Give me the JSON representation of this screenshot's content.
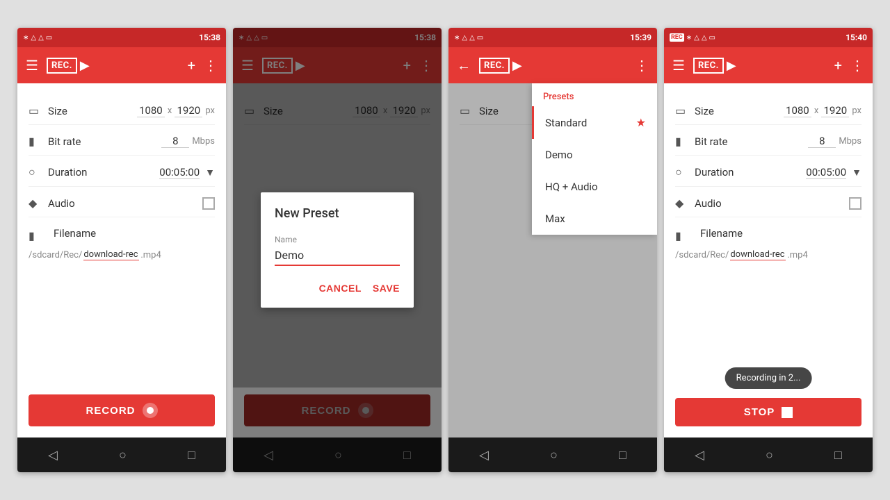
{
  "app": {
    "logo": "REC.",
    "camera_icon": "▶"
  },
  "phone1": {
    "status_time": "15:38",
    "settings": {
      "size_label": "Size",
      "size_w": "1080",
      "size_x": "x",
      "size_h": "1920",
      "size_unit": "px",
      "bitrate_label": "Bit rate",
      "bitrate_value": "8",
      "bitrate_unit": "Mbps",
      "duration_label": "Duration",
      "duration_value": "00:05:00",
      "audio_label": "Audio",
      "filename_label": "Filename",
      "filename_path": "/sdcard/Rec/",
      "filename_name": "download-rec",
      "filename_ext": ".mp4"
    },
    "record_btn": "RECORD",
    "nav": {
      "back": "◁",
      "home": "○",
      "recents": "□"
    }
  },
  "phone2": {
    "status_time": "15:38",
    "dialog": {
      "title": "New Preset",
      "name_label": "Name",
      "name_value": "Demo",
      "cancel_btn": "CANCEL",
      "save_btn": "SAVE"
    },
    "record_btn": "RECORD",
    "nav": {
      "back": "◁",
      "home": "○",
      "recents": "□"
    }
  },
  "phone3": {
    "status_time": "15:39",
    "presets": {
      "header": "Presets",
      "items": [
        {
          "label": "Standard",
          "active": true
        },
        {
          "label": "Demo",
          "active": false
        },
        {
          "label": "HQ + Audio",
          "active": false
        },
        {
          "label": "Max",
          "active": false
        }
      ]
    },
    "nav": {
      "back": "◁",
      "home": "○",
      "recents": "□"
    }
  },
  "phone4": {
    "status_time": "15:40",
    "toast": "Recording in 2...",
    "stop_btn": "STOP",
    "settings": {
      "size_label": "Size",
      "size_w": "1080",
      "size_x": "x",
      "size_h": "1920",
      "size_unit": "px",
      "bitrate_label": "Bit rate",
      "bitrate_value": "8",
      "bitrate_unit": "Mbps",
      "duration_label": "Duration",
      "duration_value": "00:05:00",
      "audio_label": "Audio",
      "filename_label": "Filename",
      "filename_path": "/sdcard/Rec/",
      "filename_name": "download-rec",
      "filename_ext": ".mp4"
    },
    "nav": {
      "back": "◁",
      "home": "○",
      "recents": "□"
    }
  }
}
